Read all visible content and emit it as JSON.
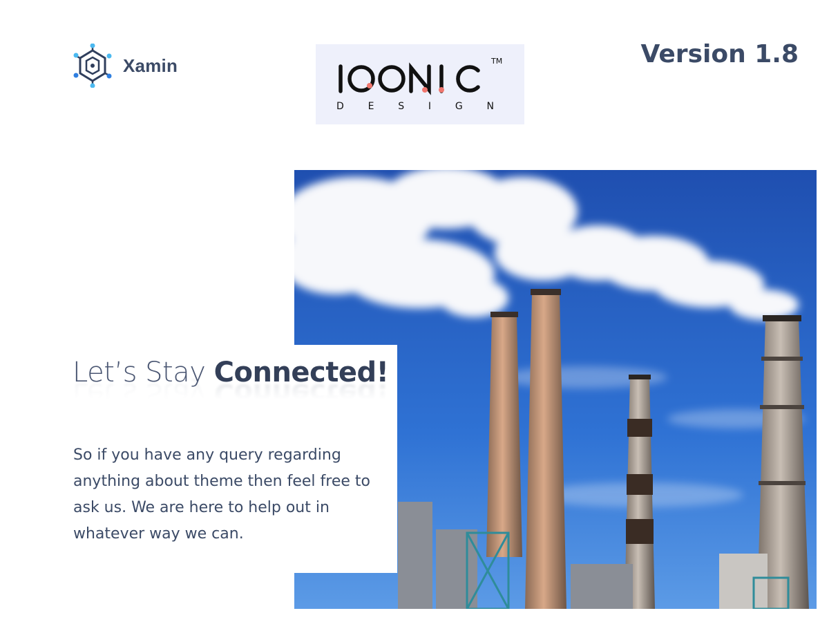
{
  "brand": {
    "name": "Xamin",
    "icon": "hexagon-network-icon",
    "icon_colors": [
      "#4bb9f0",
      "#2f3e5c"
    ]
  },
  "partner_logo": {
    "word": "IOONIC",
    "sub_letters": [
      "D",
      "E",
      "S",
      "I",
      "G",
      "N"
    ],
    "trademark": "TM",
    "accent": "#f0766e",
    "background": "#eef0fb"
  },
  "version": "Version 1.8",
  "hero": {
    "image": "factory-smokestacks-image",
    "headline_light": "Let’s Stay ",
    "headline_bold": "Connected!",
    "body": "So if you have any query regarding anything about theme then feel free to ask us. We are here to help out in whatever way we can."
  },
  "colors": {
    "text": "#3b4a66",
    "sky": "#2f6fd0"
  }
}
